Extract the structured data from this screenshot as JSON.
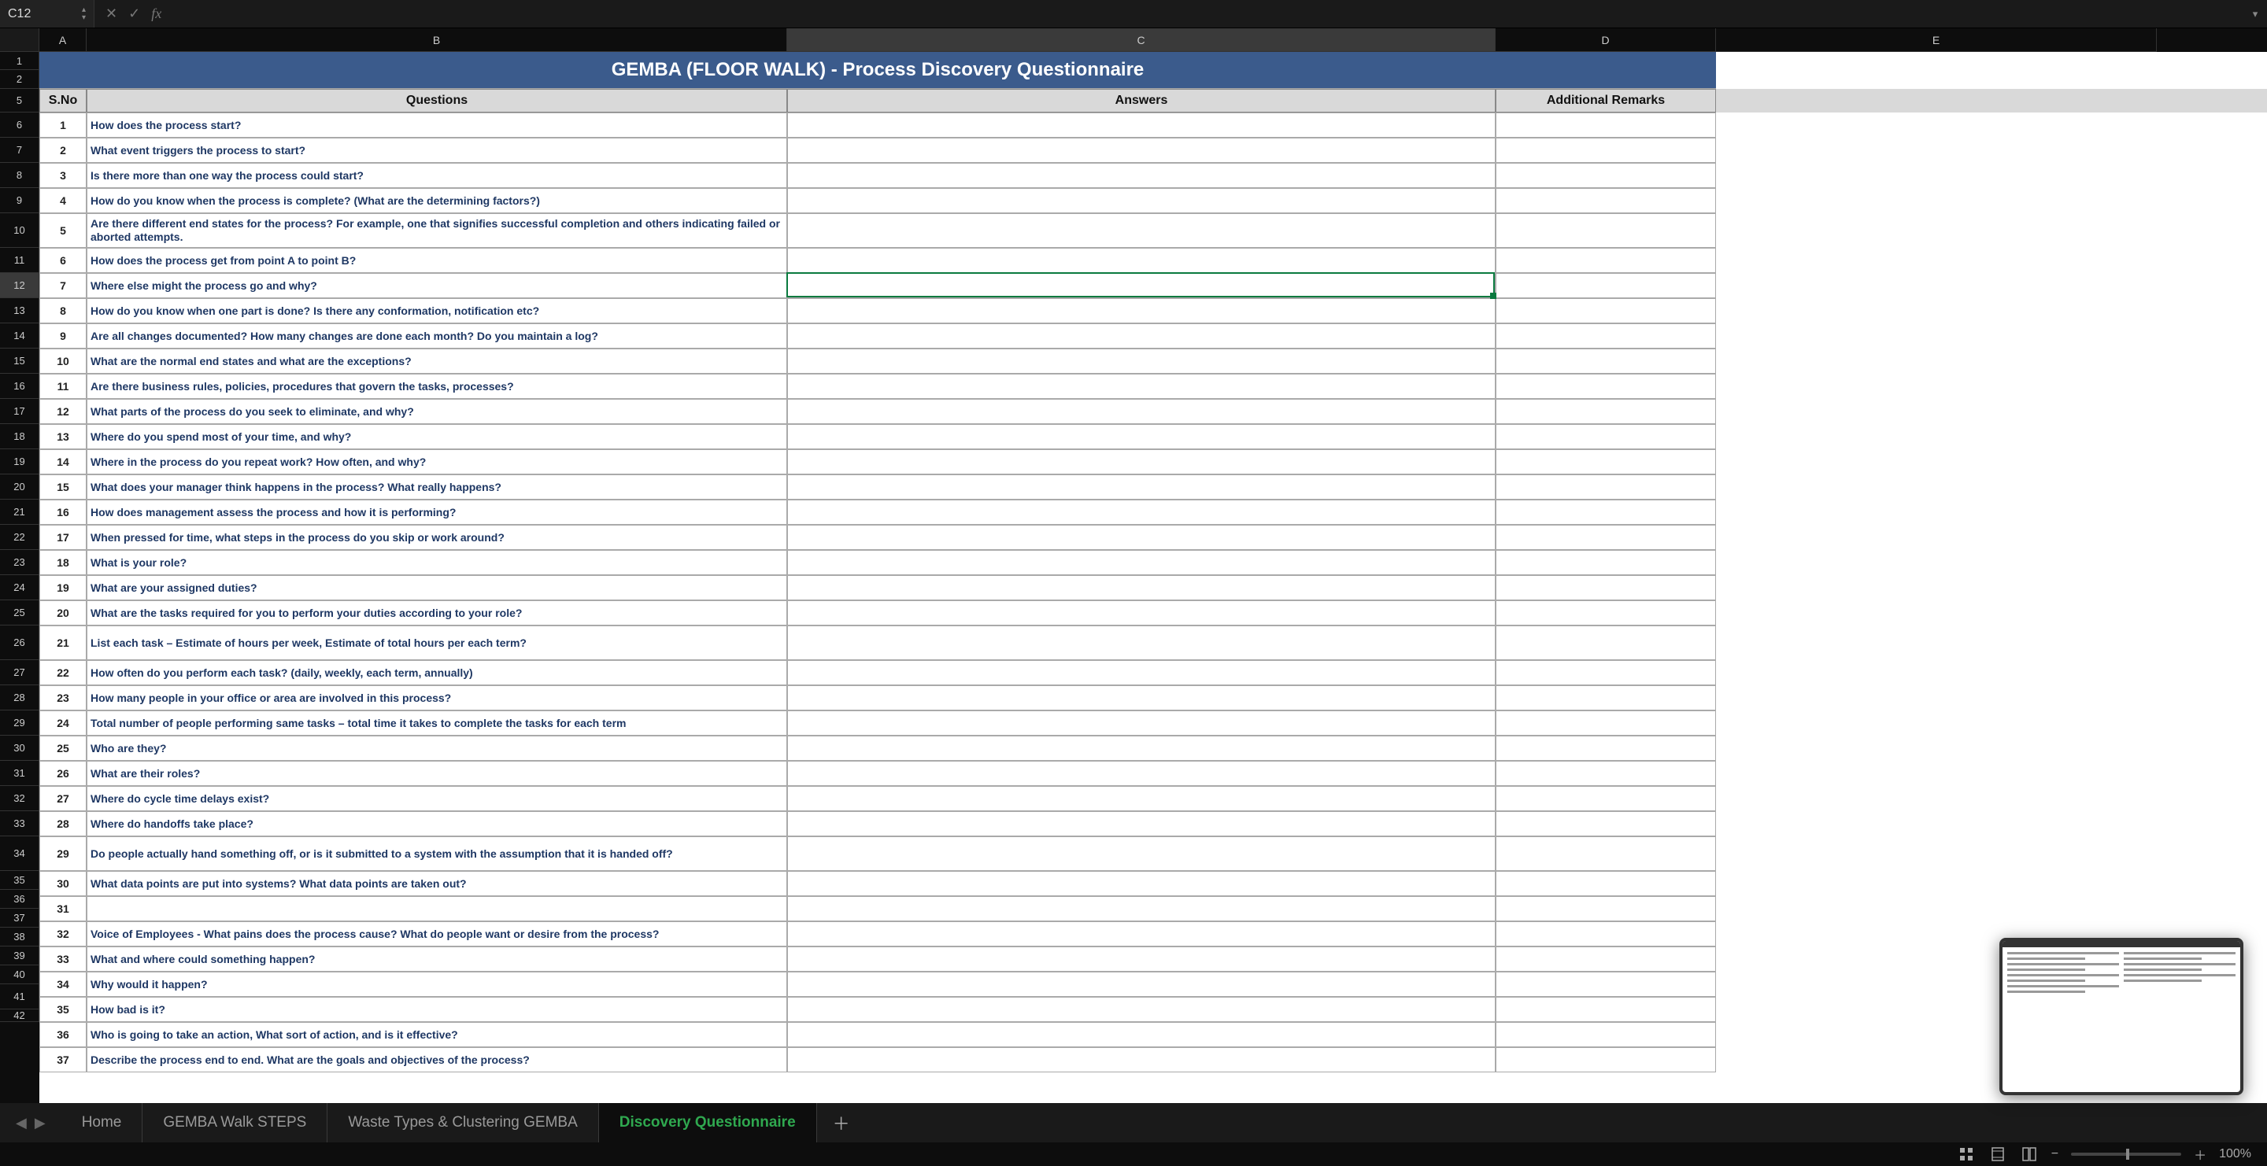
{
  "formula_bar": {
    "cell_ref": "C12",
    "fx_label": "fx"
  },
  "columns": [
    {
      "letter": "A",
      "class": "col-a"
    },
    {
      "letter": "B",
      "class": "col-b"
    },
    {
      "letter": "C",
      "class": "col-c"
    },
    {
      "letter": "D",
      "class": "col-d"
    },
    {
      "letter": "E",
      "class": "col-e"
    }
  ],
  "active_column": "C",
  "active_row": 12,
  "title_rows": [
    1,
    2
  ],
  "title": "GEMBA (FLOOR WALK) - Process Discovery Questionnaire",
  "header_row_num": 5,
  "headers": {
    "sno": "S.No",
    "questions": "Questions",
    "answers": "Answers",
    "remarks": "Additional Remarks"
  },
  "rows": [
    {
      "rn": 6,
      "sno": "1",
      "q": "How does the process start?"
    },
    {
      "rn": 7,
      "sno": "2",
      "q": "What event triggers the process to start?"
    },
    {
      "rn": 8,
      "sno": "3",
      "q": "Is there more than one way the process could start?"
    },
    {
      "rn": 9,
      "sno": "4",
      "q": "How do you know when the process is complete? (What are the determining factors?)"
    },
    {
      "rn": 10,
      "sno": "5",
      "q": "Are there different end states for the process? For example, one that signifies successful completion and others indicating failed or aborted attempts.",
      "tall": true
    },
    {
      "rn": 11,
      "sno": "6",
      "q": "How does the process get from point A to point B?"
    },
    {
      "rn": 12,
      "sno": "7",
      "q": "Where else might the process go and why?"
    },
    {
      "rn": 13,
      "sno": "8",
      "q": "How do you know when one part is done?  Is there any conformation, notification etc?"
    },
    {
      "rn": 14,
      "sno": "9",
      "q": "Are all changes documented? How many changes are done each month? Do you maintain a log?"
    },
    {
      "rn": 15,
      "sno": "10",
      "q": "What are the normal end states and what are the exceptions?"
    },
    {
      "rn": 16,
      "sno": "11",
      "q": "Are there business rules, policies, procedures that govern the tasks, processes?"
    },
    {
      "rn": 17,
      "sno": "12",
      "q": "What parts of the process do you seek to eliminate, and why?"
    },
    {
      "rn": 18,
      "sno": "13",
      "q": "Where do you spend most of your time, and why?"
    },
    {
      "rn": 19,
      "sno": "14",
      "q": "Where in the process do you repeat work? How often, and why?"
    },
    {
      "rn": 20,
      "sno": "15",
      "q": "What does your manager think happens in the process? What really happens?"
    },
    {
      "rn": 21,
      "sno": "16",
      "q": "How does management assess the process and how it is performing?"
    },
    {
      "rn": 22,
      "sno": "17",
      "q": "When pressed for time, what steps in the process do you skip or work around?"
    },
    {
      "rn": 23,
      "sno": "18",
      "q": "What is your role?"
    },
    {
      "rn": 24,
      "sno": "19",
      "q": "What are your assigned duties?"
    },
    {
      "rn": 25,
      "sno": "20",
      "q": "What are the tasks required for you to perform your duties according to your role?"
    },
    {
      "rn": 26,
      "sno": "21",
      "q": "List each task – Estimate of hours per week, Estimate of total hours per each term?",
      "tall": true
    },
    {
      "rn": 27,
      "sno": "22",
      "q": "How often do you perform each task? (daily, weekly, each term, annually)"
    },
    {
      "rn": 28,
      "sno": "23",
      "q": "How many people in your office or area are involved in this process?"
    },
    {
      "rn": 29,
      "sno": "24",
      "q": "Total number of people performing same tasks – total time it takes to complete the tasks for each term"
    },
    {
      "rn": 30,
      "sno": "25",
      "q": "Who are they?"
    },
    {
      "rn": 31,
      "sno": "26",
      "q": "What are their roles?"
    },
    {
      "rn": 32,
      "sno": "27",
      "q": "Where do cycle time delays exist?"
    },
    {
      "rn": 33,
      "sno": "28",
      "q": "Where do handoffs take place?"
    },
    {
      "rn": 34,
      "sno": "29",
      "q": "Do people actually hand something off, or is it submitted to a system with the assumption that it is handed off?",
      "tall": true
    },
    {
      "rn": 35,
      "sno": "30",
      "q": "What data points are put into systems? What data points are taken out?",
      "short": true
    },
    {
      "rn": 36,
      "sno": "31",
      "q": "",
      "short": true
    },
    {
      "rn": 37,
      "sno": "32",
      "q": "Voice of Employees - What pains does the process cause? What do people want or desire from the process?",
      "short": true,
      "combined_above": true
    },
    {
      "rn": 38,
      "sno": "33",
      "q": "What and where could something happen?",
      "short": true
    },
    {
      "rn": 39,
      "sno": "34",
      "q": "Why would it happen?",
      "short": true
    },
    {
      "rn": 40,
      "sno": "35",
      "q": "How bad is it?",
      "short": true
    },
    {
      "rn": 41,
      "sno": "36",
      "q": "Who is going to take an action, What sort of action, and is it effective?"
    }
  ],
  "cutoff_row": {
    "rn": 42,
    "sno": "37",
    "q_partial": "Describe the process end to end. What are the goals and objectives of the process?"
  },
  "sheet_tabs": [
    {
      "label": "Home",
      "active": false
    },
    {
      "label": "GEMBA Walk STEPS",
      "active": false
    },
    {
      "label": "Waste Types & Clustering GEMBA",
      "active": false
    },
    {
      "label": "Discovery Questionnaire",
      "active": true
    }
  ],
  "status_bar": {
    "zoom_text": "100%"
  }
}
